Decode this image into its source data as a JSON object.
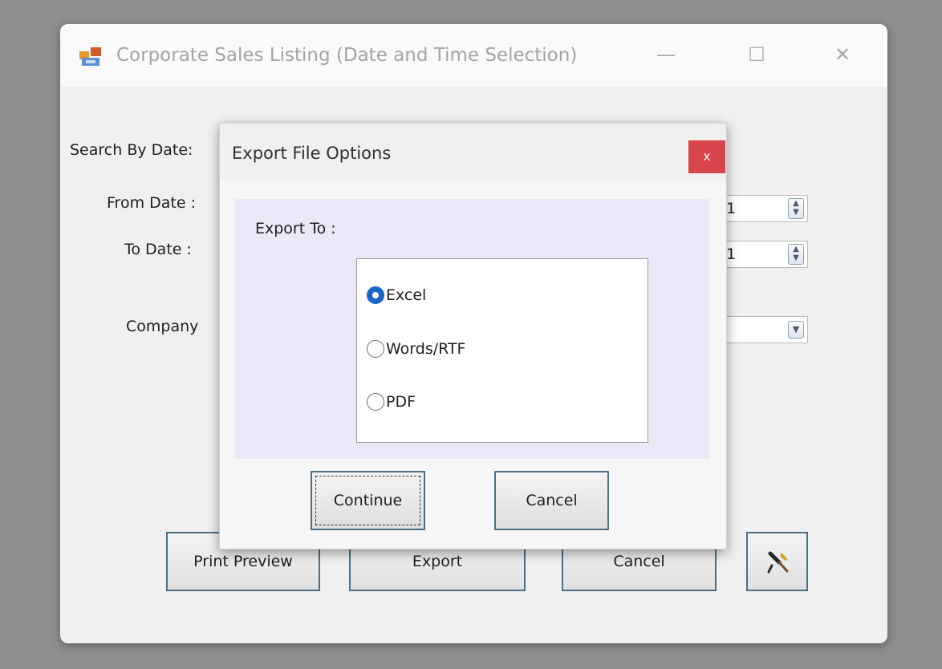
{
  "main_window": {
    "title": "Corporate Sales Listing (Date and Time Selection)",
    "labels": {
      "search_by_date": "Search By Date:",
      "from_date": "From Date :",
      "to_date": "To Date :",
      "company": "Company"
    },
    "from_date_value_fragment": "1",
    "to_date_value_fragment": "1",
    "buttons": {
      "print_preview": "Print Preview",
      "export": "Export",
      "cancel": "Cancel"
    },
    "icons": {
      "app": "app-window-icon",
      "tool": "tool-hammer-icon",
      "minimize": "minimize-icon",
      "maximize": "maximize-icon",
      "close": "close-icon"
    }
  },
  "export_dialog": {
    "title": "Export File Options",
    "close_label": "x",
    "export_to_label": "Export To :",
    "options": [
      {
        "label": "Excel",
        "checked": true
      },
      {
        "label": "Words/RTF",
        "checked": false
      },
      {
        "label": "PDF",
        "checked": false
      }
    ],
    "buttons": {
      "continue": "Continue",
      "cancel": "Cancel"
    }
  },
  "colors": {
    "close_button": "#d8454b",
    "radio_selected": "#1a66c8",
    "panel_background": "#e9e9f7",
    "button_border": "#4c6f86"
  }
}
